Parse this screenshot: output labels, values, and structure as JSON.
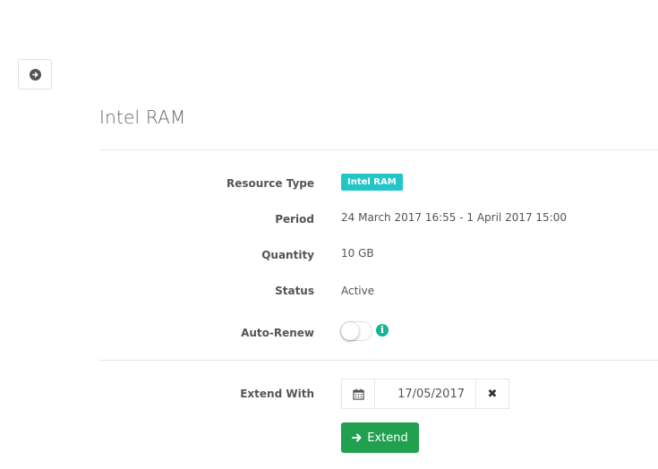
{
  "page": {
    "title": "Intel RAM"
  },
  "details": {
    "resource_type_label": "Resource Type",
    "resource_type_value": "Intel RAM",
    "period_label": "Period",
    "period_value": "24 March 2017 16:55 - 1 April 2017 15:00",
    "quantity_label": "Quantity",
    "quantity_value": "10 GB",
    "status_label": "Status",
    "status_value": "Active",
    "auto_renew_label": "Auto-Renew",
    "auto_renew_on": false
  },
  "extend": {
    "label": "Extend With",
    "date_value": "17/05/2017",
    "button_label": "Extend"
  },
  "icons": {
    "back": "circle-arrow-right-icon",
    "info": "info-circle-icon",
    "calendar": "calendar-icon",
    "clear": "times-icon",
    "extend": "arrow-right-icon"
  },
  "colors": {
    "badge": "#23c6c8",
    "primary_button": "#21a04f",
    "info_icon": "#1ab394"
  }
}
